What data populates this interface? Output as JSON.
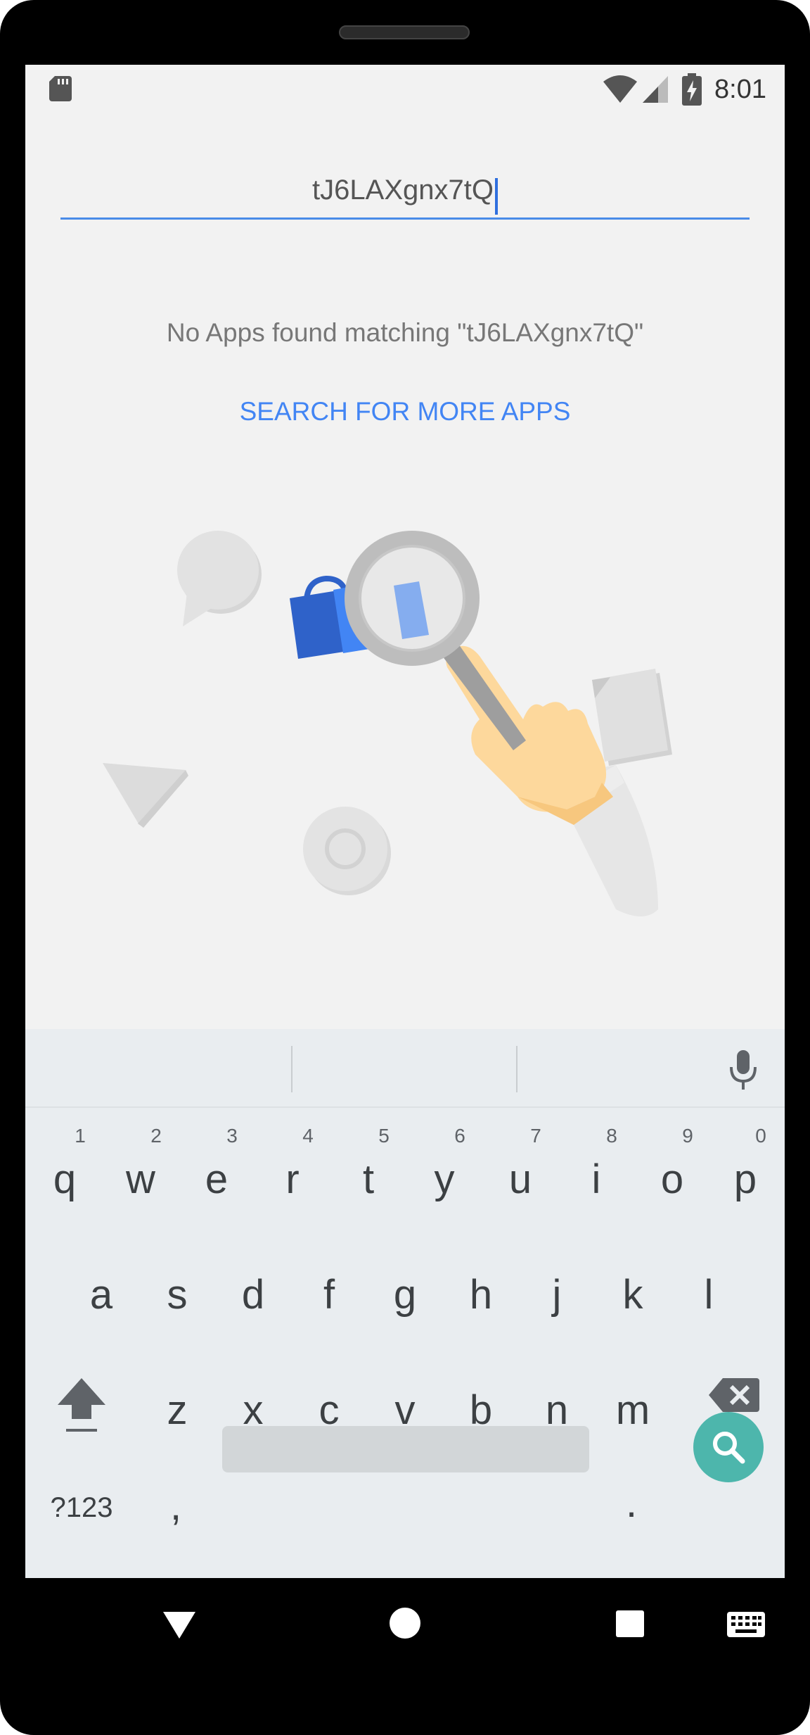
{
  "status_bar": {
    "time": "8:01",
    "icons": [
      "sd-card-icon",
      "wifi-icon",
      "signal-icon",
      "battery-charging-icon"
    ]
  },
  "search": {
    "query": "tJ6LAXgnx7tQ"
  },
  "results": {
    "empty_message": "No Apps found matching \"tJ6LAXgnx7tQ\"",
    "search_more_label": "SEARCH FOR MORE APPS"
  },
  "keyboard": {
    "row1": [
      {
        "key": "q",
        "hint": "1"
      },
      {
        "key": "w",
        "hint": "2"
      },
      {
        "key": "e",
        "hint": "3"
      },
      {
        "key": "r",
        "hint": "4"
      },
      {
        "key": "t",
        "hint": "5"
      },
      {
        "key": "y",
        "hint": "6"
      },
      {
        "key": "u",
        "hint": "7"
      },
      {
        "key": "i",
        "hint": "8"
      },
      {
        "key": "o",
        "hint": "9"
      },
      {
        "key": "p",
        "hint": "0"
      }
    ],
    "row2": [
      "a",
      "s",
      "d",
      "f",
      "g",
      "h",
      "j",
      "k",
      "l"
    ],
    "row3": [
      "z",
      "x",
      "c",
      "v",
      "b",
      "n",
      "m"
    ],
    "symbols_label": "?123",
    "comma": ",",
    "period": "."
  },
  "nav_bar": {
    "icons": [
      "back-icon",
      "home-icon",
      "recents-icon",
      "keyboard-switch-icon"
    ]
  },
  "colors": {
    "accent": "#4285f4",
    "search_fab": "#4db6ac",
    "keyboard_bg": "#e9edf0",
    "screen_bg": "#f2f2f2"
  }
}
